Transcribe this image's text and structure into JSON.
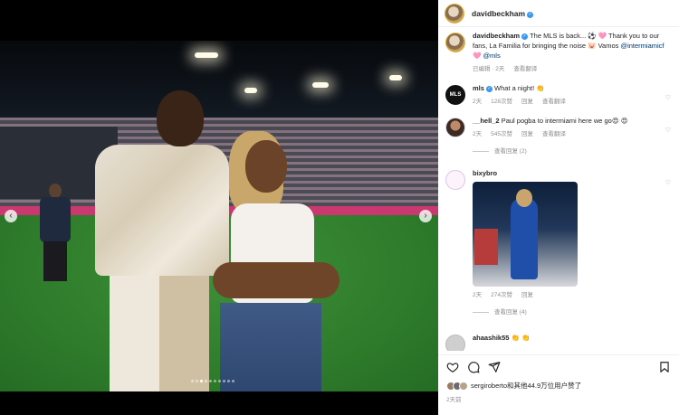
{
  "post": {
    "username": "davidbeckham",
    "nav_prev": "‹",
    "nav_next": "›",
    "carousel_count": 10,
    "carousel_active_index": 2
  },
  "caption": {
    "username": "davidbeckham",
    "text": "The MLS is back... ⚽ 🩷 Thank you to our fans, La Familia for bringing the noise 🐷 Vamos ",
    "mention_1": "@intermiamicf",
    "mention_2": "@mls",
    "heart_prefix": "🩷",
    "edited": "已编辑 · 2天",
    "translate": "查看翻译"
  },
  "comments": [
    {
      "username": "mls",
      "avatar_text": "MLS",
      "text": "What a night! 👏",
      "time": "2天",
      "likes": "128次赞",
      "reply": "回复",
      "translate": "查看翻译"
    },
    {
      "username": "__hell_2",
      "text": "Paul pogba to intermiami here we go😍 😍",
      "time": "2天",
      "likes": "545次赞",
      "reply": "回复",
      "translate": "查看翻译",
      "view_replies": "查看回复 (2)"
    },
    {
      "username": "bixybro",
      "time": "2天",
      "likes": "274次赞",
      "reply": "回复",
      "view_replies": "查看回复 (4)"
    },
    {
      "username": "ahaashik55",
      "text": "👏 👏"
    }
  ],
  "footer": {
    "likes_text": "sergiroberto和其他44.9万位用户赞了",
    "time": "2天前"
  },
  "icons": {
    "like": "heart-icon",
    "comment": "comment-icon",
    "share": "share-icon",
    "save": "bookmark-icon"
  },
  "colors": {
    "verified": "#3897f0",
    "link": "#00376b",
    "meta": "#8e8e8e"
  }
}
